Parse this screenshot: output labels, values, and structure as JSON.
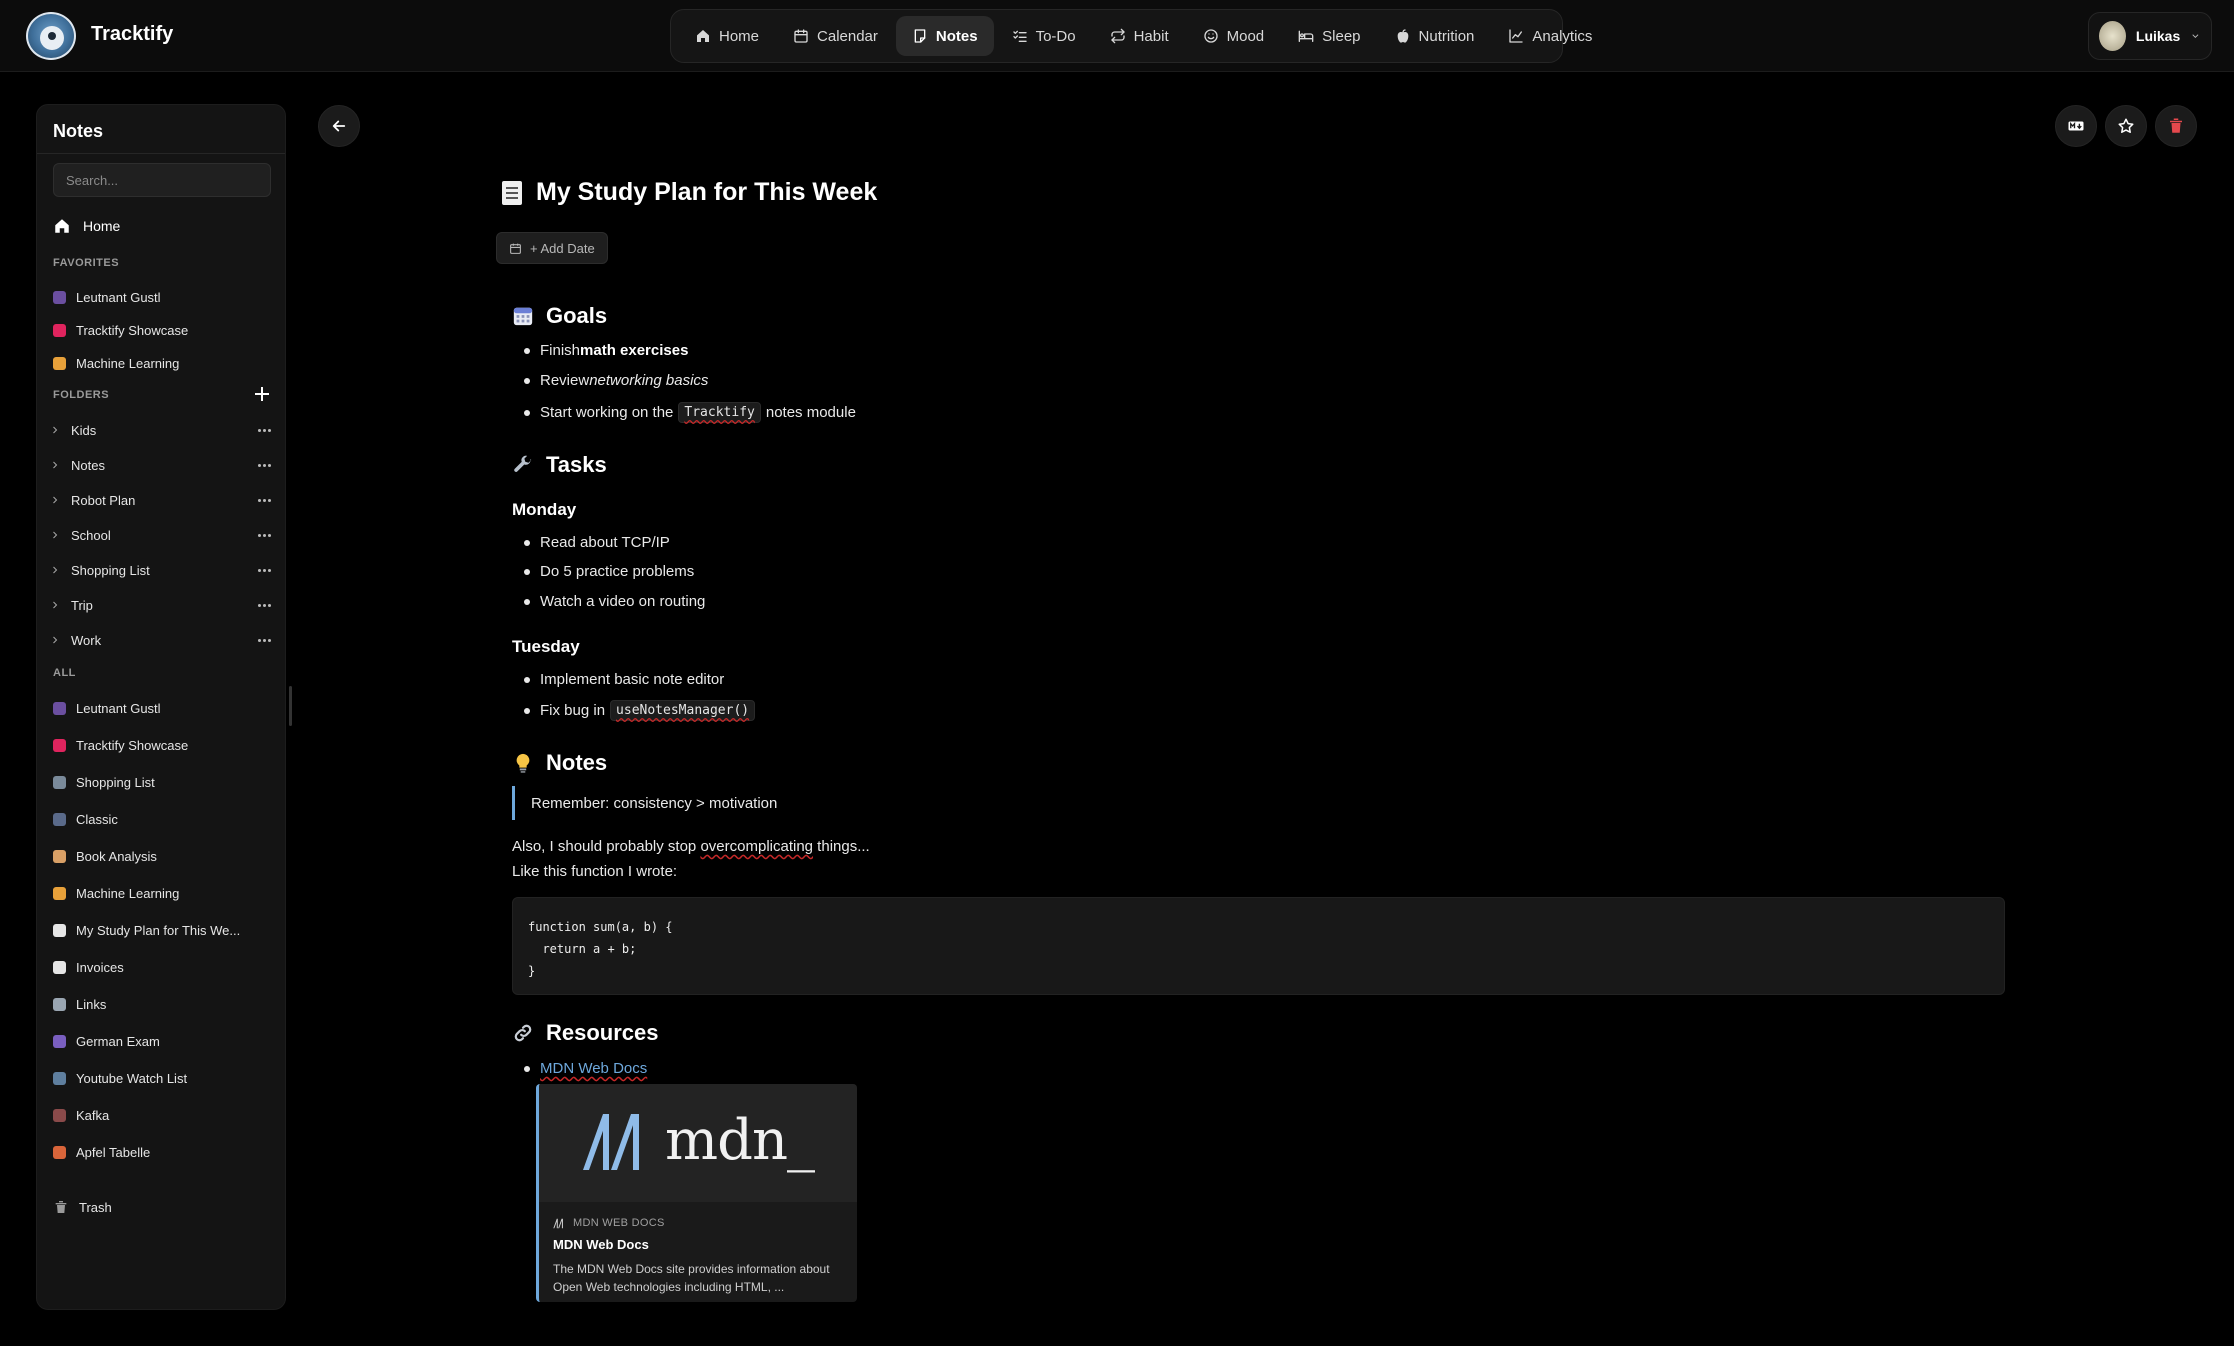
{
  "app": {
    "brand": "Tracktify",
    "user_name": "Luikas"
  },
  "nav": [
    {
      "label": "Home",
      "icon": "home-icon"
    },
    {
      "label": "Calendar",
      "icon": "calendar-icon"
    },
    {
      "label": "Notes",
      "icon": "note-icon",
      "active": true
    },
    {
      "label": "To-Do",
      "icon": "checklist-icon"
    },
    {
      "label": "Habit",
      "icon": "repeat-icon"
    },
    {
      "label": "Mood",
      "icon": "smile-icon"
    },
    {
      "label": "Sleep",
      "icon": "bed-icon"
    },
    {
      "label": "Nutrition",
      "icon": "apple-icon"
    },
    {
      "label": "Analytics",
      "icon": "chart-line-icon"
    }
  ],
  "sidebar": {
    "title": "Notes",
    "search_placeholder": "Search...",
    "home_label": "Home",
    "favorites_label": "FAVORITES",
    "favorites": [
      {
        "label": "Leutnant Gustl",
        "color": "#6b4fa0"
      },
      {
        "label": "Tracktify Showcase",
        "color": "#e0245e"
      },
      {
        "label": "Machine Learning",
        "color": "#e8a13a"
      }
    ],
    "folders_label": "FOLDERS",
    "folders": [
      "Kids",
      "Notes",
      "Robot Plan",
      "School",
      "Shopping List",
      "Trip",
      "Work"
    ],
    "all_label": "ALL",
    "all": [
      {
        "label": "Leutnant Gustl",
        "color": "#6b4fa0"
      },
      {
        "label": "Tracktify Showcase",
        "color": "#e0245e"
      },
      {
        "label": "Shopping List",
        "color": "#7a8a9a"
      },
      {
        "label": "Classic",
        "color": "#5a6a8a"
      },
      {
        "label": "Book Analysis",
        "color": "#d9a066"
      },
      {
        "label": "Machine Learning",
        "color": "#e8a13a"
      },
      {
        "label": "My Study Plan for This We...",
        "color": "#e6e6e6"
      },
      {
        "label": "Invoices",
        "color": "#e6e6e6"
      },
      {
        "label": "Links",
        "color": "#9aa6b2"
      },
      {
        "label": "German Exam",
        "color": "#7a5fc0"
      },
      {
        "label": "Youtube Watch List",
        "color": "#5f7f9f"
      },
      {
        "label": "Kafka",
        "color": "#8a4a4a"
      },
      {
        "label": "Apfel Tabelle",
        "color": "#d9653a"
      }
    ],
    "trash_label": "Trash"
  },
  "note": {
    "title": "My Study Plan for This Week",
    "add_date_label": "+ Add Date",
    "goals": {
      "heading": "Goals",
      "items": [
        {
          "pre": "Finish ",
          "bold": "math exercises"
        },
        {
          "pre": "Review ",
          "italic": "networking basics"
        },
        {
          "pre": "Start working on the",
          "code": "Tracktify",
          "post": "notes module"
        }
      ]
    },
    "tasks": {
      "heading": "Tasks",
      "monday": {
        "heading": "Monday",
        "items": [
          "Read about TCP/IP",
          "Do 5 practice problems",
          "Watch a video on routing"
        ]
      },
      "tuesday": {
        "heading": "Tuesday",
        "items": [
          {
            "text": "Implement basic note editor"
          },
          {
            "pre": "Fix bug in",
            "code": "useNotesManager()"
          }
        ]
      }
    },
    "notes": {
      "heading": "Notes",
      "quote": "Remember: consistency > motivation",
      "para1_pre": "Also, I should probably stop ",
      "para1_spell": "overcomplicating",
      "para1_post": " things...",
      "para2": "Like this function I wrote:",
      "code": "function sum(a, b) {\n  return a + b;\n}"
    },
    "resources": {
      "heading": "Resources",
      "link_text": "MDN Web Docs",
      "card": {
        "image_text": "mdn_",
        "site": "MDN WEB DOCS",
        "title": "MDN Web Docs",
        "description": "The MDN Web Docs site provides information about Open Web technologies including HTML, ..."
      }
    }
  },
  "colors": {
    "accent": "#6ea8dc",
    "danger": "#e5484d",
    "background": "#000000",
    "panel": "#141414"
  }
}
